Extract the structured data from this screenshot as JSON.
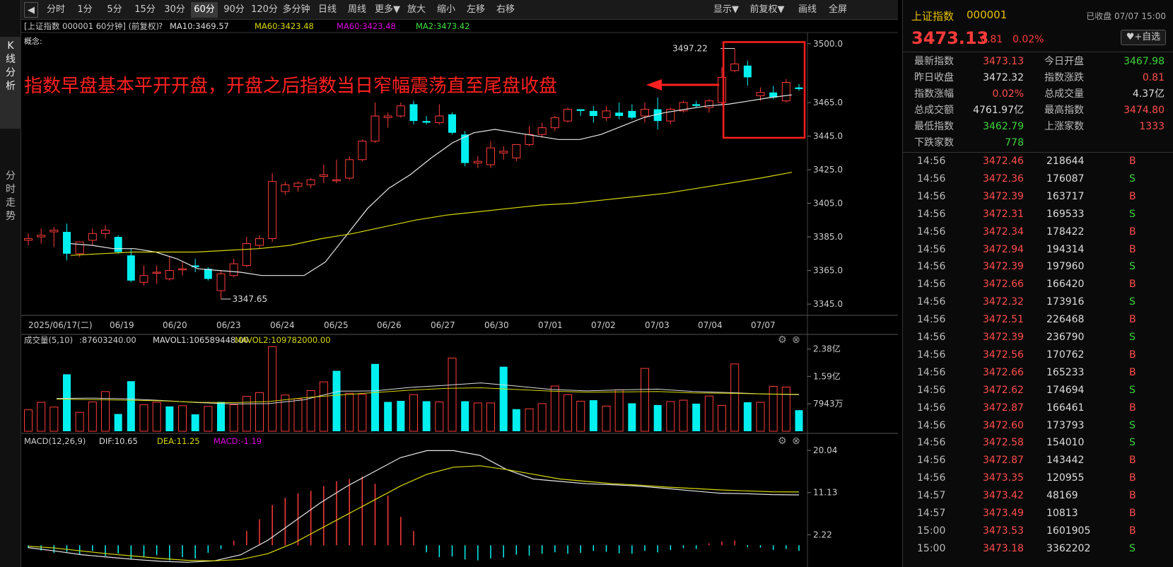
{
  "sidebar": {
    "tabs": [
      {
        "label": "K\n线\n分\n析",
        "active": true
      },
      {
        "label": "分\n时\n走\n势",
        "active": false
      }
    ]
  },
  "toolbar": {
    "items": [
      "分时",
      "1分",
      "5分",
      "15分",
      "30分",
      "60分",
      "90分",
      "120分",
      "多分钟",
      "日线",
      "周线",
      "更多▼",
      "放大",
      "缩小",
      "左移",
      "右移"
    ],
    "active_index": 5,
    "right_items": [
      "显示▼",
      "前复权▼",
      "画线",
      "全屏"
    ]
  },
  "legend": {
    "prefix": "[上证指数 000001 60分钟]  (前复权)",
    "help": "?",
    "ma10": "MA10:3469.57",
    "ma60a": "MA60:3423.48",
    "ma60b": "MA60:3423.48",
    "ma2": "MA2:3473.42",
    "concept": "概念:"
  },
  "colors": {
    "up": "#ff3b3b",
    "down": "#00f0f0",
    "ma_white": "#e8e8e8",
    "ma_yellow": "#d8d800",
    "ma_magenta": "#e000e0",
    "ma_green": "#40e040",
    "annotation": "#ff2020"
  },
  "annotation": {
    "text": "指数早盘基本平开开盘，开盘之后指数当日窄幅震荡直至尾盘收盘"
  },
  "chart_data": [
    {
      "type": "candlestick",
      "title": "上证指数 000001 60分钟",
      "x_labels": [
        "2025/06/17(二)",
        "06/19",
        "06/20",
        "06/23",
        "06/24",
        "06/25",
        "06/26",
        "06/27",
        "06/30",
        "07/01",
        "07/02",
        "07/03",
        "07/04",
        "07/07"
      ],
      "y_ticks": [
        "3500.0",
        "3465.0",
        "3445.0",
        "3425.0",
        "3405.0",
        "3385.0",
        "3365.0",
        "3345.0"
      ],
      "ylim": [
        3340,
        3505
      ],
      "max_label": "3497.22",
      "min_label": "3347.65",
      "ohlc": [
        [
          3383,
          3387,
          3380,
          3384
        ],
        [
          3385,
          3390,
          3381,
          3386
        ],
        [
          3388,
          3391,
          3379,
          3389
        ],
        [
          3388,
          3393,
          3371,
          3375
        ],
        [
          3375,
          3382,
          3373,
          3382
        ],
        [
          3383,
          3390,
          3380,
          3387
        ],
        [
          3387,
          3392,
          3384,
          3389
        ],
        [
          3385,
          3386,
          3375,
          3376
        ],
        [
          3374,
          3378,
          3358,
          3359
        ],
        [
          3358,
          3368,
          3356,
          3362
        ],
        [
          3364,
          3368,
          3357,
          3364
        ],
        [
          3360,
          3373,
          3359,
          3365
        ],
        [
          3366,
          3370,
          3362,
          3366
        ],
        [
          3368,
          3372,
          3364,
          3367
        ],
        [
          3366,
          3367,
          3359,
          3360
        ],
        [
          3353,
          3365,
          3348,
          3363
        ],
        [
          3362,
          3372,
          3361,
          3369
        ],
        [
          3368,
          3385,
          3367,
          3381
        ],
        [
          3380,
          3386,
          3378,
          3384
        ],
        [
          3384,
          3423,
          3382,
          3418
        ],
        [
          3412,
          3418,
          3410,
          3416
        ],
        [
          3415,
          3418,
          3412,
          3417
        ],
        [
          3416,
          3420,
          3414,
          3419
        ],
        [
          3421,
          3428,
          3417,
          3422
        ],
        [
          3419,
          3431,
          3417,
          3419
        ],
        [
          3420,
          3433,
          3419,
          3431
        ],
        [
          3431,
          3443,
          3430,
          3442
        ],
        [
          3442,
          3465,
          3441,
          3457
        ],
        [
          3456,
          3459,
          3450,
          3457
        ],
        [
          3457,
          3465,
          3456,
          3463
        ],
        [
          3464,
          3466,
          3452,
          3454
        ],
        [
          3454,
          3457,
          3452,
          3453
        ],
        [
          3453,
          3464,
          3452,
          3457
        ],
        [
          3458,
          3459,
          3446,
          3447
        ],
        [
          3446,
          3448,
          3427,
          3429
        ],
        [
          3429,
          3433,
          3426,
          3430
        ],
        [
          3428,
          3442,
          3426,
          3438
        ],
        [
          3435,
          3439,
          3431,
          3436
        ],
        [
          3432,
          3440,
          3430,
          3440
        ],
        [
          3440,
          3451,
          3439,
          3446
        ],
        [
          3446,
          3453,
          3444,
          3450
        ],
        [
          3450,
          3457,
          3448,
          3456
        ],
        [
          3454,
          3462,
          3453,
          3461
        ],
        [
          3461,
          3461,
          3457,
          3460
        ],
        [
          3460,
          3463,
          3453,
          3457
        ],
        [
          3456,
          3463,
          3454,
          3460
        ],
        [
          3459,
          3465,
          3455,
          3457
        ],
        [
          3460,
          3464,
          3455,
          3456
        ],
        [
          3457,
          3465,
          3453,
          3461
        ],
        [
          3461,
          3468,
          3449,
          3454
        ],
        [
          3454,
          3462,
          3452,
          3461
        ],
        [
          3460,
          3466,
          3459,
          3465
        ],
        [
          3464,
          3466,
          3462,
          3463
        ],
        [
          3462,
          3467,
          3459,
          3466
        ],
        [
          3465,
          3486,
          3464,
          3480
        ],
        [
          3484,
          3497.22,
          3483,
          3488
        ],
        [
          3487,
          3490,
          3475,
          3480
        ],
        [
          3469,
          3474,
          3466,
          3471
        ],
        [
          3471,
          3475,
          3467,
          3468
        ],
        [
          3466,
          3479,
          3465,
          3477
        ],
        [
          3474,
          3476,
          3472,
          3473
        ]
      ],
      "ma": [
        {
          "name": "MA10",
          "color_key": "ma_white",
          "values": [
            3381,
            3380,
            3378,
            3378,
            3376,
            3372,
            3366,
            3365,
            3364,
            3362,
            3362,
            3362,
            3370,
            3386,
            3402,
            3414,
            3422,
            3432,
            3441,
            3447,
            3449,
            3447,
            3445,
            3443,
            3443,
            3446,
            3451,
            3456,
            3459,
            3461,
            3463,
            3464,
            3466,
            3468,
            3469.57
          ]
        },
        {
          "name": "MA60",
          "color_key": "ma_yellow",
          "values": [
            3374,
            3375,
            3376,
            3376,
            3376,
            3377,
            3378,
            3380,
            3384,
            3387,
            3391,
            3395,
            3398,
            3400,
            3402,
            3404,
            3405,
            3407,
            3409,
            3411,
            3414,
            3417,
            3420,
            3423.48
          ]
        }
      ]
    },
    {
      "type": "bar",
      "title": "成交量(5,10)",
      "header": {
        "label": "成交量(5,10)",
        "vol": ":87603240.00",
        "mavol1": "MAVOL1:106589448.00",
        "mavol2": "MAVOL2:109782000.00"
      },
      "y_ticks": [
        "2.38亿",
        "1.59亿",
        "7943万"
      ],
      "ylim": [
        0,
        2.6
      ],
      "unit": "亿",
      "values": [
        0.62,
        0.84,
        0.7,
        1.65,
        0.55,
        0.85,
        1.15,
        0.5,
        1.45,
        0.77,
        0.84,
        0.72,
        0.74,
        0.49,
        0.72,
        0.85,
        0.77,
        1.01,
        1.12,
        2.45,
        1.05,
        0.94,
        1.18,
        1.43,
        1.75,
        1.1,
        1.07,
        1.95,
        0.85,
        0.88,
        1.06,
        0.87,
        0.85,
        2.12,
        0.87,
        0.82,
        0.82,
        1.87,
        0.64,
        0.65,
        0.8,
        1.31,
        1.06,
        0.87,
        0.9,
        0.73,
        1.2,
        0.81,
        1.82,
        0.76,
        0.86,
        0.9,
        0.8,
        1.02,
        0.75,
        1.95,
        0.84,
        0.84,
        1.3,
        1.28,
        0.61
      ],
      "down_flags": [
        0,
        0,
        0,
        1,
        0,
        0,
        0,
        1,
        1,
        0,
        0,
        1,
        0,
        1,
        0,
        1,
        0,
        0,
        0,
        0,
        0,
        0,
        0,
        0,
        1,
        0,
        0,
        1,
        1,
        1,
        0,
        1,
        0,
        0,
        1,
        0,
        0,
        1,
        1,
        0,
        0,
        0,
        0,
        0,
        1,
        0,
        0,
        1,
        0,
        1,
        0,
        0,
        1,
        0,
        0,
        0,
        1,
        0,
        0,
        0,
        1
      ],
      "mavol1": [
        0.95,
        0.96,
        0.94,
        0.89,
        0.83,
        0.79,
        0.8,
        0.91,
        1.16,
        1.17,
        1.27,
        1.33,
        1.4,
        1.31,
        1.21,
        1.17,
        1.2,
        1.22,
        1.15,
        1.12,
        1.08,
        1.06
      ],
      "mavol2": [
        0.93,
        0.92,
        0.9,
        0.88,
        0.84,
        0.83,
        0.86,
        0.97,
        1.05,
        1.12,
        1.19,
        1.24,
        1.26,
        1.21,
        1.16,
        1.13,
        1.14,
        1.15,
        1.11,
        1.1,
        1.08,
        1.07
      ]
    },
    {
      "type": "line",
      "title": "MACD(12,26,9)",
      "header": {
        "label": "MACD(12,26,9)",
        "dif": "DIF:10.65",
        "dea": "DEA:11.25",
        "macd": "MACD:-1.19"
      },
      "y_ticks": [
        "20.04",
        "11.13",
        "2.22"
      ],
      "ylim": [
        -4,
        22
      ],
      "series": [
        {
          "name": "DIF",
          "values": [
            -0.5,
            -1.2,
            -2.0,
            -2.5,
            -3.0,
            -3.4,
            -3.6,
            -3.3,
            -2.0,
            1.0,
            5.0,
            9.0,
            12.5,
            15.5,
            18.5,
            20.0,
            20.0,
            19.0,
            16.0,
            14.0,
            13.5,
            13.0,
            12.8,
            12.5,
            12.0,
            11.5,
            11.0,
            10.9,
            10.7,
            10.65
          ]
        },
        {
          "name": "DEA",
          "values": [
            -0.2,
            -0.6,
            -1.2,
            -1.8,
            -2.3,
            -2.8,
            -3.2,
            -3.3,
            -3.0,
            -1.8,
            0.5,
            3.5,
            6.5,
            9.5,
            12.5,
            15.0,
            16.5,
            16.8,
            16.0,
            15.0,
            14.0,
            13.5,
            13.0,
            12.7,
            12.3,
            12.0,
            11.7,
            11.5,
            11.3,
            11.25
          ]
        }
      ],
      "histogram": [
        -0.6,
        -1.1,
        -1.6,
        -1.4,
        -1.9,
        -1.2,
        -2.3,
        -1.7,
        -3.0,
        -2.4,
        -2.1,
        -3.2,
        -2.5,
        -2.8,
        -1.6,
        -0.8,
        1.0,
        3.0,
        5.5,
        8.5,
        10.0,
        11.0,
        11.5,
        12.5,
        13.5,
        14.0,
        14.5,
        13.0,
        10.5,
        6.0,
        3.0,
        -1.5,
        -2.5,
        -2.4,
        -3.0,
        -3.2,
        -2.8,
        -2.6,
        -2.0,
        -2.2,
        -1.8,
        -1.5,
        -1.8,
        -1.6,
        -1.2,
        -1.4,
        -1.7,
        -1.8,
        -1.2,
        -1.5,
        -1.0,
        -0.6,
        -0.8,
        0.4,
        0.8,
        1.0,
        -0.4,
        -0.5,
        -1.0,
        -0.8,
        -1.19
      ]
    }
  ],
  "quote": {
    "name": "上证指数",
    "code": "000001",
    "date": "已收盘 07/07 15:00",
    "price": "3473.13",
    "change": "0.81",
    "pct": "0.02%",
    "fav": "♥+自选",
    "stats": [
      [
        {
          "label": "最新指数",
          "value": "3473.13",
          "color": "#ff4d4d"
        },
        {
          "label": "今日开盘",
          "value": "3467.98",
          "color": "#3cd33c"
        }
      ],
      [
        {
          "label": "昨日收盘",
          "value": "3472.32",
          "color": "#ddd"
        },
        {
          "label": "指数涨跌",
          "value": "0.81",
          "color": "#ff4d4d"
        }
      ],
      [
        {
          "label": "指数涨幅",
          "value": "0.02%",
          "color": "#ff4d4d"
        },
        {
          "label": "总成交量",
          "value": "4.37亿",
          "color": "#ddd"
        }
      ],
      [
        {
          "label": "总成交额",
          "value": "4761.97亿",
          "color": "#ddd"
        },
        {
          "label": "最高指数",
          "value": "3474.80",
          "color": "#ff4d4d"
        }
      ],
      [
        {
          "label": "最低指数",
          "value": "3462.79",
          "color": "#3cd33c"
        },
        {
          "label": "上涨家数",
          "value": "1333",
          "color": "#ff4d4d"
        }
      ],
      [
        {
          "label": "下跌家数",
          "value": "778",
          "color": "#3cd33c"
        }
      ]
    ],
    "ticks": [
      [
        "14:56",
        "3472.46",
        "218644",
        "B"
      ],
      [
        "14:56",
        "3472.36",
        "176087",
        "S"
      ],
      [
        "14:56",
        "3472.39",
        "163717",
        "B"
      ],
      [
        "14:56",
        "3472.31",
        "169533",
        "S"
      ],
      [
        "14:56",
        "3472.34",
        "178422",
        "B"
      ],
      [
        "14:56",
        "3472.94",
        "194314",
        "B"
      ],
      [
        "14:56",
        "3472.39",
        "197960",
        "S"
      ],
      [
        "14:56",
        "3472.66",
        "166420",
        "B"
      ],
      [
        "14:56",
        "3472.32",
        "173916",
        "S"
      ],
      [
        "14:56",
        "3472.51",
        "226468",
        "B"
      ],
      [
        "14:56",
        "3472.39",
        "236790",
        "S"
      ],
      [
        "14:56",
        "3472.56",
        "170762",
        "B"
      ],
      [
        "14:56",
        "3472.66",
        "165233",
        "B"
      ],
      [
        "14:56",
        "3472.62",
        "174694",
        "S"
      ],
      [
        "14:56",
        "3472.87",
        "166461",
        "B"
      ],
      [
        "14:56",
        "3472.60",
        "173793",
        "S"
      ],
      [
        "14:56",
        "3472.58",
        "154010",
        "S"
      ],
      [
        "14:56",
        "3472.87",
        "143442",
        "B"
      ],
      [
        "14:56",
        "3473.35",
        "120955",
        "B"
      ],
      [
        "14:57",
        "3473.42",
        "48169",
        "B"
      ],
      [
        "14:57",
        "3473.49",
        "10813",
        "B"
      ],
      [
        "15:00",
        "3473.53",
        "1601905",
        "B"
      ],
      [
        "15:00",
        "3473.18",
        "3362202",
        "S"
      ]
    ]
  }
}
